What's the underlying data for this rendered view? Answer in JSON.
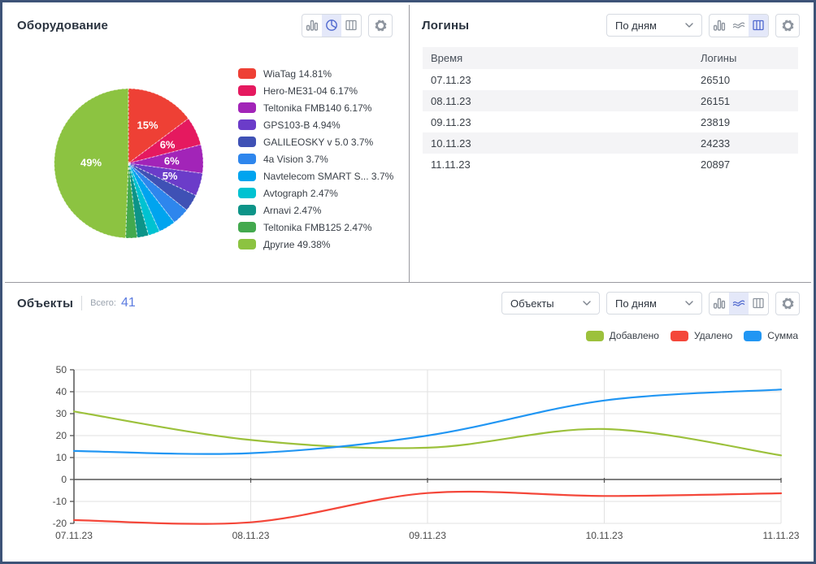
{
  "colors": {
    "accent": "#5069cf",
    "accent_selected_bg": "#e4e8f9",
    "frame_border": "#3d5377",
    "divider": "#9a9aa0",
    "total_value_blue": "#5b7be0"
  },
  "icons": {
    "bar": "bar-chart-icon",
    "pie": "pie-chart-icon",
    "stream": "line-chart-icon",
    "table": "table-view-icon",
    "gear": "settings-gear-icon",
    "chevron": "chevron-down-icon"
  },
  "equipment_panel": {
    "title": "Оборудование",
    "views": [
      "bar",
      "pie",
      "table"
    ],
    "active_view": "pie",
    "chart_data": {
      "type": "pie",
      "legend_position": "right",
      "slices": [
        {
          "label": "WiaTag",
          "pct": 14.81,
          "color": "#ee4035",
          "legend": "WiaTag 14.81%"
        },
        {
          "label": "Hero-ME31-04",
          "pct": 6.17,
          "color": "#e5195f",
          "legend": "Hero-ME31-04 6.17%"
        },
        {
          "label": "Teltonika FMB140",
          "pct": 6.17,
          "color": "#a224b8",
          "legend": "Teltonika FMB140 6.17%"
        },
        {
          "label": "GPS103-B",
          "pct": 4.94,
          "color": "#6b3cc9",
          "legend": "GPS103-B 4.94%"
        },
        {
          "label": "GALILEOSKY v 5.0",
          "pct": 3.7,
          "color": "#3f51b5",
          "legend": "GALILEOSKY v 5.0 3.7%"
        },
        {
          "label": "4a Vision",
          "pct": 3.7,
          "color": "#2e86ed",
          "legend": "4a Vision 3.7%"
        },
        {
          "label": "Navtelecom SMART S...",
          "pct": 3.7,
          "color": "#00a4ef",
          "legend": "Navtelecom SMART S... 3.7%"
        },
        {
          "label": "Avtograph",
          "pct": 2.47,
          "color": "#00c2d1",
          "legend": "Avtograph 2.47%"
        },
        {
          "label": "Arnavi",
          "pct": 2.47,
          "color": "#0d9488",
          "legend": "Arnavi 2.47%"
        },
        {
          "label": "Teltonika FMB125",
          "pct": 2.47,
          "color": "#43a94e",
          "legend": "Teltonika FMB125 2.47%"
        },
        {
          "label": "Другие",
          "pct": 49.38,
          "color": "#8cc341",
          "legend": "Другие  49.38%"
        }
      ]
    }
  },
  "logins_panel": {
    "title": "Логины",
    "period_select": {
      "value": "По дням"
    },
    "views": [
      "bar",
      "stream",
      "table"
    ],
    "active_view": "table",
    "table": {
      "headers": [
        "Время",
        "Логины"
      ],
      "rows": [
        [
          "07.11.23",
          "26510"
        ],
        [
          "08.11.23",
          "26151"
        ],
        [
          "09.11.23",
          "23819"
        ],
        [
          "10.11.23",
          "24233"
        ],
        [
          "11.11.23",
          "20897"
        ]
      ]
    }
  },
  "objects_panel": {
    "title": "Объекты",
    "total_label": "Всего:",
    "total_value": "41",
    "entity_select": {
      "value": "Объекты"
    },
    "period_select": {
      "value": "По дням"
    },
    "views": [
      "bar",
      "stream",
      "table"
    ],
    "active_view": "stream",
    "chart_data": {
      "type": "line",
      "x": [
        "07.11.23",
        "08.11.23",
        "09.11.23",
        "10.11.23",
        "11.11.23"
      ],
      "series": [
        {
          "name": "Добавлено",
          "color": "#9cc13c",
          "values": [
            31,
            18,
            14.5,
            23,
            11
          ]
        },
        {
          "name": "Удалено",
          "color": "#f4473a",
          "values": [
            -18.5,
            -19.5,
            -6.2,
            -7.5,
            -6.3
          ]
        },
        {
          "name": "Сумма",
          "color": "#2196f3",
          "values": [
            13,
            12,
            20,
            36,
            41
          ]
        }
      ],
      "ylim": [
        -20,
        50
      ],
      "yticks": [
        50,
        40,
        30,
        20,
        10,
        0,
        -10,
        -20
      ],
      "grid": true,
      "legend_position": "top-right"
    }
  }
}
